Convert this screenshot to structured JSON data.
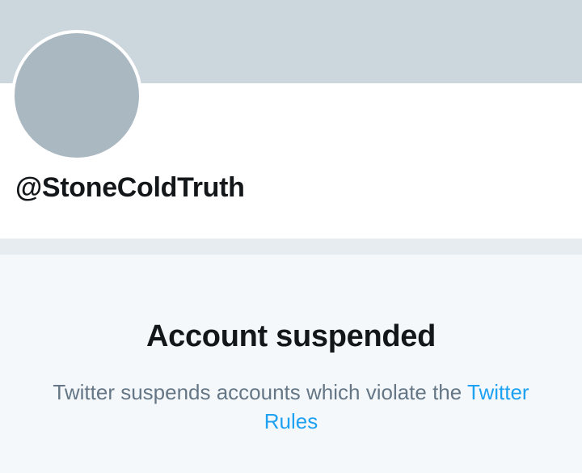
{
  "profile": {
    "handle": "@StoneColdTruth"
  },
  "suspension": {
    "title": "Account suspended",
    "message": "Twitter suspends accounts which violate the",
    "link_text": "Twitter Rules"
  },
  "colors": {
    "banner": "#ccd6dd",
    "avatar": "#aab8c2",
    "separator": "#e6ecf0",
    "notice_background": "#f5f8fa",
    "text_primary": "#14171a",
    "text_secondary": "#657786",
    "link": "#1da1f2"
  }
}
